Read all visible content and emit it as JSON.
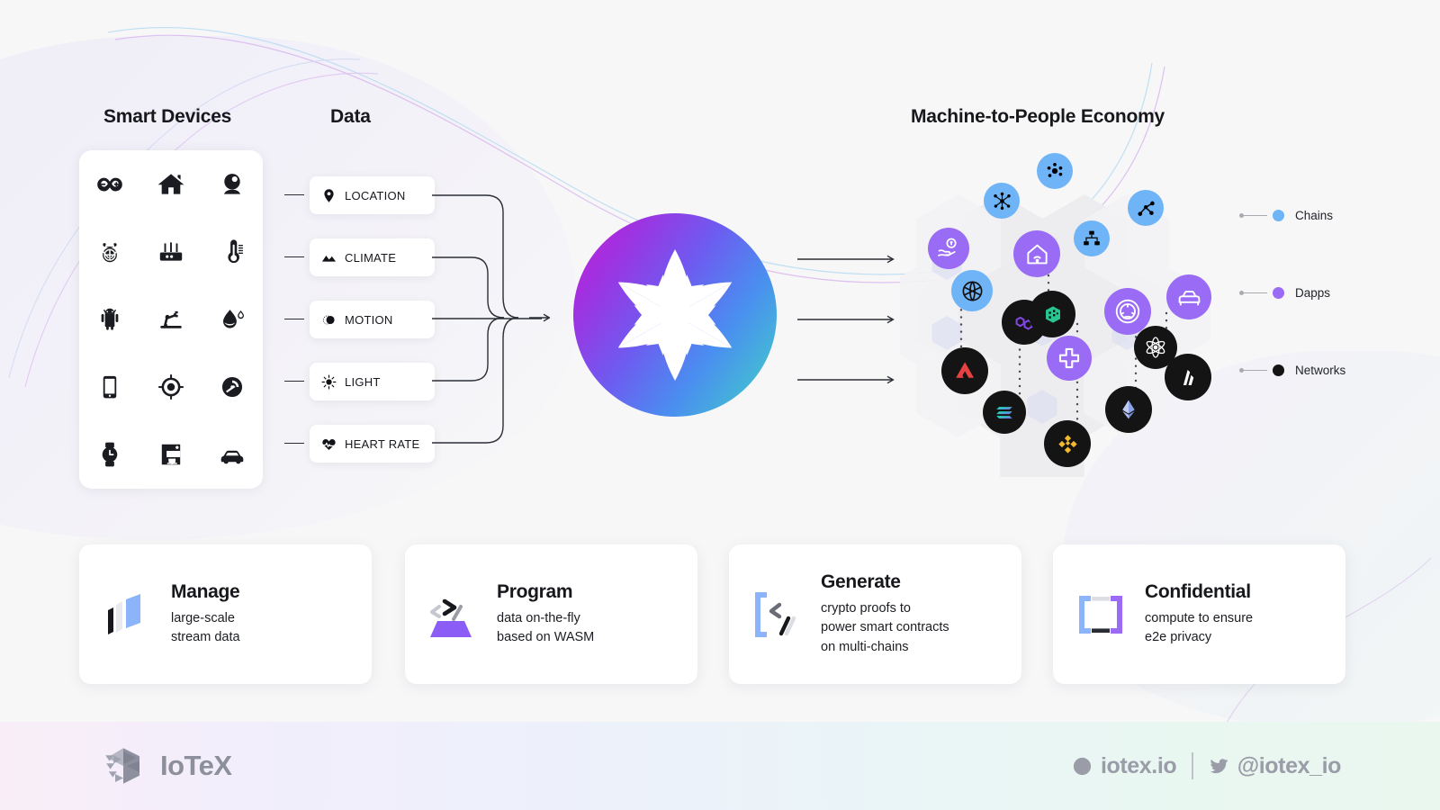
{
  "titles": {
    "smart_devices": "Smart Devices",
    "data": "Data",
    "economy": "Machine-to-People Economy"
  },
  "devices": [
    {
      "name": "arduino-icon",
      "label": "Arduino"
    },
    {
      "name": "home-icon",
      "label": "Smart Home"
    },
    {
      "name": "webcam-icon",
      "label": "Webcam"
    },
    {
      "name": "raspberry-pi-icon",
      "label": "Raspberry Pi"
    },
    {
      "name": "router-icon",
      "label": "Router"
    },
    {
      "name": "thermometer-icon",
      "label": "Thermometer"
    },
    {
      "name": "android-icon",
      "label": "Android"
    },
    {
      "name": "robot-arm-icon",
      "label": "Robot Arm"
    },
    {
      "name": "water-drop-icon",
      "label": "Water Drop"
    },
    {
      "name": "smartphone-icon",
      "label": "Smartphone"
    },
    {
      "name": "gps-target-icon",
      "label": "GPS Tracker"
    },
    {
      "name": "gauge-icon",
      "label": "Gauge"
    },
    {
      "name": "smartwatch-icon",
      "label": "Smartwatch"
    },
    {
      "name": "coffee-machine-icon",
      "label": "Coffee Machine"
    },
    {
      "name": "car-icon",
      "label": "Connected Car"
    }
  ],
  "data_tags": [
    {
      "label": "LOCATION",
      "icon": "map-pin-icon"
    },
    {
      "label": "CLIMATE",
      "icon": "mountains-icon"
    },
    {
      "label": "MOTION",
      "icon": "motion-icon"
    },
    {
      "label": "LIGHT",
      "icon": "sun-icon"
    },
    {
      "label": "HEART RATE",
      "icon": "heart-pulse-icon"
    }
  ],
  "logo": {
    "name": "iotex-flower-logo",
    "gradient_from": "#c42ad4",
    "gradient_mid": "#4a8ef0",
    "gradient_to": "#4fcdc0"
  },
  "legend": [
    {
      "label": "Chains",
      "color": "#6fb4f7"
    },
    {
      "label": "Dapps",
      "color": "#9a6bf5"
    },
    {
      "label": "Networks",
      "color": "#141414"
    }
  ],
  "cluster_nodes": [
    {
      "icon": "node-cluster-icon",
      "type": "chain",
      "label": "Chains"
    },
    {
      "icon": "hub-spoke-icon",
      "type": "chain",
      "label": "Chains"
    },
    {
      "icon": "graph-nodes-icon",
      "type": "chain",
      "label": "Chains"
    },
    {
      "icon": "network-tree-icon",
      "type": "chain",
      "label": "Chains"
    },
    {
      "icon": "globe-grid-icon",
      "type": "chain",
      "label": "Chains"
    },
    {
      "icon": "defi-hand-icon",
      "type": "dapp",
      "label": "Dapps"
    },
    {
      "icon": "smart-home-icon",
      "type": "dapp",
      "label": "Dapps"
    },
    {
      "icon": "steering-wheel-icon",
      "type": "dapp",
      "label": "Dapps"
    },
    {
      "icon": "car-side-icon",
      "type": "dapp",
      "label": "Dapps"
    },
    {
      "icon": "medical-cross-icon",
      "type": "dapp",
      "label": "Dapps"
    },
    {
      "icon": "avalanche-icon",
      "type": "network",
      "label": "Networks"
    },
    {
      "icon": "polygon-icon",
      "type": "network",
      "label": "Networks"
    },
    {
      "icon": "solana-icon",
      "type": "network",
      "label": "Networks"
    },
    {
      "icon": "iotex-cube-icon",
      "type": "network",
      "label": "Networks"
    },
    {
      "icon": "binance-icon",
      "type": "network",
      "label": "Networks"
    },
    {
      "icon": "ethereum-icon",
      "type": "network",
      "label": "Networks"
    },
    {
      "icon": "cosmos-icon",
      "type": "network",
      "label": "Networks"
    },
    {
      "icon": "arbitrum-icon",
      "type": "network",
      "label": "Networks"
    }
  ],
  "cards": [
    {
      "title": "Manage",
      "desc": "large-scale\nstream data",
      "icon": "stream-bars-icon"
    },
    {
      "title": "Program",
      "desc": "data on-the-fly\nbased on WASM",
      "icon": "code-wasm-icon"
    },
    {
      "title": "Generate",
      "desc": "crypto proofs to\npower smart contracts\non multi-chains",
      "icon": "bracket-proof-icon"
    },
    {
      "title": "Confidential",
      "desc": "compute to ensure\ne2e privacy",
      "icon": "privacy-brackets-icon"
    }
  ],
  "footer": {
    "brand": "IoTeX",
    "brand_icon": "iotex-cube-logo",
    "website": "iotex.io",
    "website_icon": "globe-icon",
    "twitter": "@iotex_io",
    "twitter_icon": "twitter-bird-icon"
  }
}
